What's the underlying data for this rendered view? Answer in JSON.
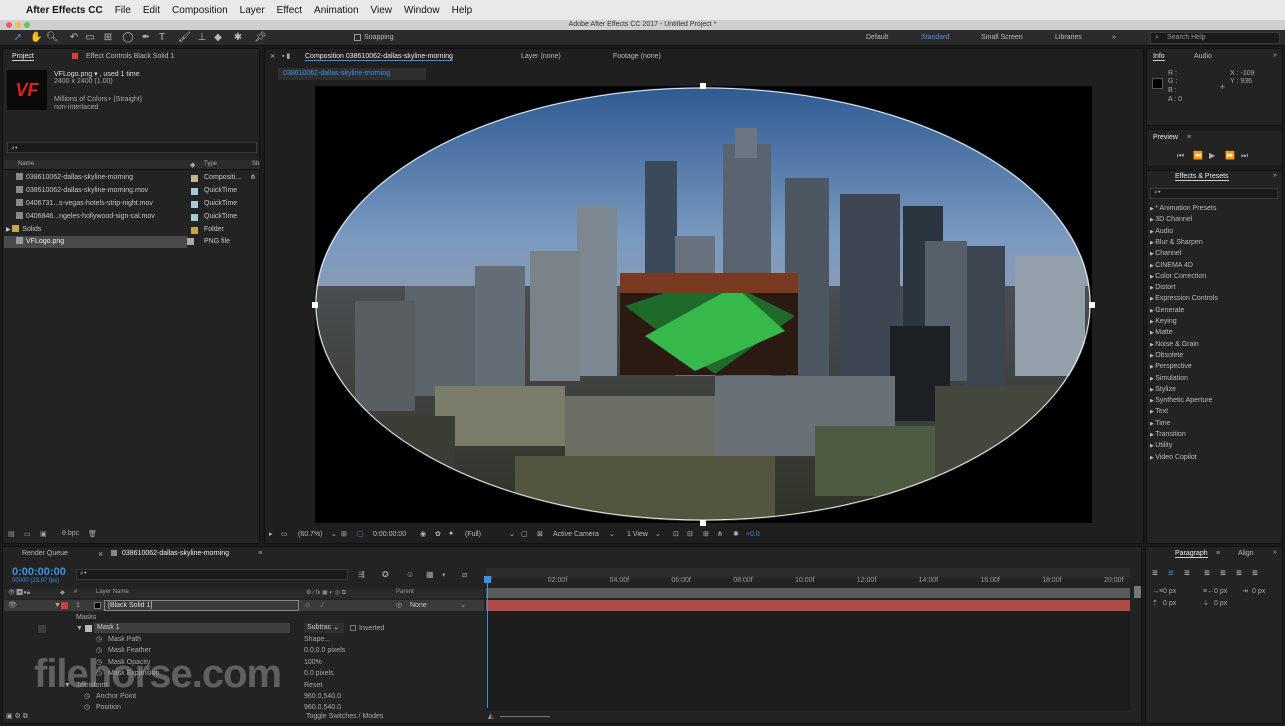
{
  "mac_menu": {
    "app": "After Effects CC",
    "items": [
      "File",
      "Edit",
      "Composition",
      "Layer",
      "Effect",
      "Animation",
      "View",
      "Window",
      "Help"
    ]
  },
  "window_title": "Adobe After Effects CC 2017 - Untitled Project *",
  "toolbar": {
    "snapping": "Snapping",
    "workspaces": [
      "Default",
      "Standard",
      "Small Screen",
      "Libraries"
    ],
    "active_workspace": "Standard",
    "search_placeholder": "Search Help"
  },
  "project": {
    "tab": "Project",
    "effect_controls": "Effect Controls Black Solid 1",
    "file_name": "VFLogo.png ▾ , used 1 time",
    "dims": "2400 x 2400 (1.00)",
    "colors": "Millions of Colors+ (Straight)",
    "interlace": "non-interlaced",
    "col_name": "Name",
    "col_type": "Type",
    "col_size": "Sb",
    "items": [
      {
        "name": "038610062-dallas-skyline-morning",
        "type": "Compositi..."
      },
      {
        "name": "038610062-dallas-skyline-morning.mov",
        "type": "QuickTime"
      },
      {
        "name": "0406731...s-vegas-hotels-strip-night.mov",
        "type": "QuickTime"
      },
      {
        "name": "0406846...ngeles-hollywood-sign-cal.mov",
        "type": "QuickTime"
      },
      {
        "name": "Solids",
        "type": "Folder"
      },
      {
        "name": "VFLogo.png",
        "type": "PNG file"
      }
    ],
    "bpc": "8 bpc",
    "logo": "VF"
  },
  "viewer": {
    "comp_tab": "Composition 038610062-dallas-skyline-morning",
    "layer_tab": "Layer (none)",
    "footage_tab": "Footage (none)",
    "comp_chip": "038610062-dallas-skyline-morning",
    "zoom": "(60.7%)",
    "time": "0:00:00:00",
    "resolution": "(Full)",
    "camera": "Active Camera",
    "view": "1 View",
    "exposure": "+0.0"
  },
  "info": {
    "tab": "Info",
    "audio_tab": "Audio",
    "r": "R :",
    "g": "G :",
    "b": "B :",
    "a": "A : 0",
    "x": "X : -109",
    "y": "Y : 936"
  },
  "preview": {
    "tab": "Preview"
  },
  "effects": {
    "tab": "Effects & Presets",
    "items": [
      "* Animation Presets",
      "3D Channel",
      "Audio",
      "Blur & Sharpen",
      "Channel",
      "CINEMA 4D",
      "Color Correction",
      "Distort",
      "Expression Controls",
      "Generate",
      "Keying",
      "Matte",
      "Noise & Grain",
      "Obsolete",
      "Perspective",
      "Simulation",
      "Stylize",
      "Synthetic Aperture",
      "Text",
      "Time",
      "Transition",
      "Utility",
      "Video Copilot"
    ]
  },
  "timeline": {
    "render_queue": "Render Queue",
    "comp_tab": "038610062-dallas-skyline-morning",
    "timecode": "0:00:00:00",
    "frames": "00000 (23.97 fps)",
    "layer_name_col": "Layer Name",
    "parent_col": "Parent",
    "layer_num": "1",
    "layer_name": "[Black Solid 1]",
    "parent_value": "None",
    "masks": "Masks",
    "mask1": "Mask 1",
    "mask_mode": "Subtrac",
    "inverted": "Inverted",
    "props": [
      {
        "name": "Mask Path",
        "value": "Shape..."
      },
      {
        "name": "Mask Feather",
        "value": "0.0,0.0 pixels"
      },
      {
        "name": "Mask Opacity",
        "value": "100%"
      },
      {
        "name": "Mask Expansion",
        "value": "0.0 pixels"
      }
    ],
    "transform": "Transform",
    "transform_reset": "Reset",
    "anchor": "Anchor Point",
    "anchor_value": "960.0,540.0",
    "position": "Position",
    "position_value": "960.0,540.0",
    "toggle": "Toggle Switches / Modes",
    "ticks": [
      "0f",
      "02:00f",
      "04:00f",
      "06:00f",
      "08:00f",
      "10:00f",
      "12:00f",
      "14:00f",
      "16:00f",
      "18:00f",
      "20:00f"
    ]
  },
  "paragraph": {
    "tab": "Paragraph",
    "align_tab": "Align",
    "values": [
      "0 px",
      "0 px",
      "0 px",
      "0 px",
      "0 px"
    ]
  },
  "watermark": "filehorse.com"
}
